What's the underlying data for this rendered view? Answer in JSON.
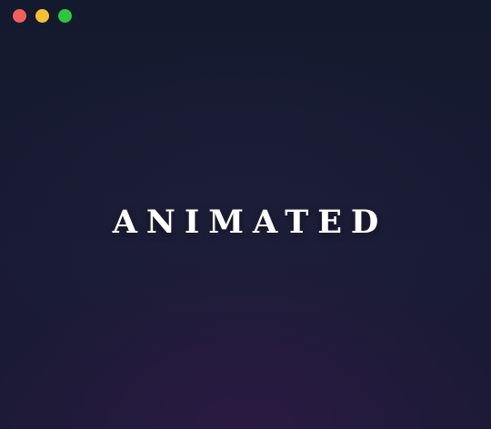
{
  "window": {
    "controls": {
      "close_color": "#f25f58",
      "minimize_color": "#f6bf2f",
      "zoom_color": "#2ec53f"
    }
  },
  "main": {
    "headline": "ANIMATED"
  },
  "colors": {
    "background_top": "#141a2d",
    "background_glow": "#2a1a42",
    "text": "#ffffff"
  }
}
